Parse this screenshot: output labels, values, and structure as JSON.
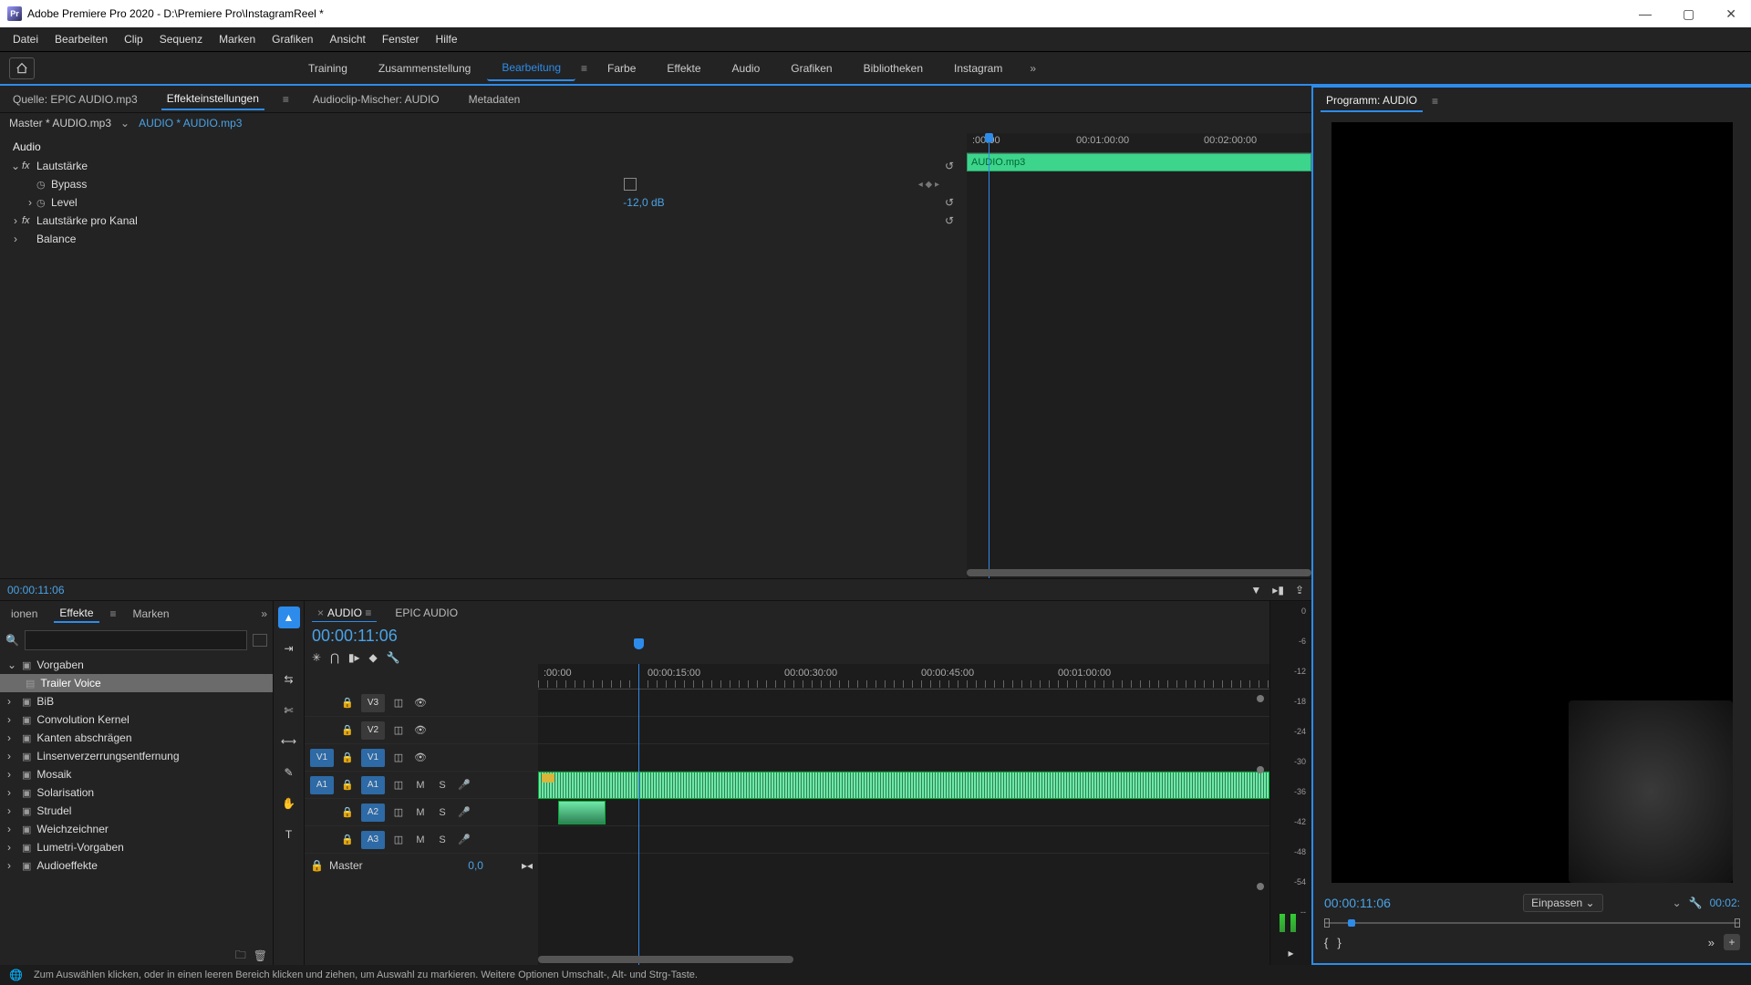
{
  "titlebar": {
    "title": "Adobe Premiere Pro 2020 - D:\\Premiere Pro\\InstagramReel *"
  },
  "menubar": [
    "Datei",
    "Bearbeiten",
    "Clip",
    "Sequenz",
    "Marken",
    "Grafiken",
    "Ansicht",
    "Fenster",
    "Hilfe"
  ],
  "workspaces": [
    "Training",
    "Zusammenstellung",
    "Bearbeitung",
    "Farbe",
    "Effekte",
    "Audio",
    "Grafiken",
    "Bibliotheken",
    "Instagram"
  ],
  "source_tabs": {
    "source": "Quelle: EPIC AUDIO.mp3",
    "effect": "Effekteinstellungen",
    "mixer": "Audioclip-Mischer: AUDIO",
    "meta": "Metadaten"
  },
  "effect_controls": {
    "master": "Master * AUDIO.mp3",
    "clip": "AUDIO * AUDIO.mp3",
    "section": "Audio",
    "volume": "Lautstärke",
    "bypass": "Bypass",
    "level": "Level",
    "level_value": "-12,0 dB",
    "channel_volume": "Lautstärke pro Kanal",
    "balance": "Balance",
    "mini_times": {
      "t0": ":00:00",
      "t1": "00:01:00:00",
      "t2": "00:02:00:00"
    },
    "clip_name": "AUDIO.mp3",
    "timecode": "00:00:11:06"
  },
  "effects_panel": {
    "cut_tab": "ionen",
    "effects": "Effekte",
    "marks": "Marken",
    "presets": "Vorgaben",
    "selected": "Trailer Voice",
    "items": [
      "BiB",
      "Convolution Kernel",
      "Kanten abschrägen",
      "Linsenverzerrungsentfernung",
      "Mosaik",
      "Solarisation",
      "Strudel",
      "Weichzeichner",
      "Lumetri-Vorgaben",
      "Audioeffekte"
    ]
  },
  "timeline": {
    "tab1": "AUDIO",
    "tab2": "EPIC AUDIO",
    "tc": "00:00:11:06",
    "ruler": [
      ":00:00",
      "00:00:15:00",
      "00:00:30:00",
      "00:00:45:00",
      "00:01:00:00"
    ],
    "tracks": {
      "v3": "V3",
      "v2": "V2",
      "v1": "V1",
      "a1": "A1",
      "a2": "A2",
      "a3": "A3",
      "src_v1": "V1",
      "src_a1": "A1",
      "m": "M",
      "s": "S"
    },
    "master": "Master",
    "master_val": "0,0"
  },
  "meter_db": [
    "0",
    "-6",
    "-12",
    "-18",
    "-24",
    "-30",
    "-36",
    "-42",
    "-48",
    "-54",
    "--"
  ],
  "program": {
    "label": "Programm: AUDIO",
    "tc": "00:00:11:06",
    "zoom": "Einpassen",
    "tc_r": "00:02:"
  },
  "statusbar": "Zum Auswählen klicken, oder in einen leeren Bereich klicken und ziehen, um Auswahl zu markieren. Weitere Optionen Umschalt-, Alt- und Strg-Taste."
}
